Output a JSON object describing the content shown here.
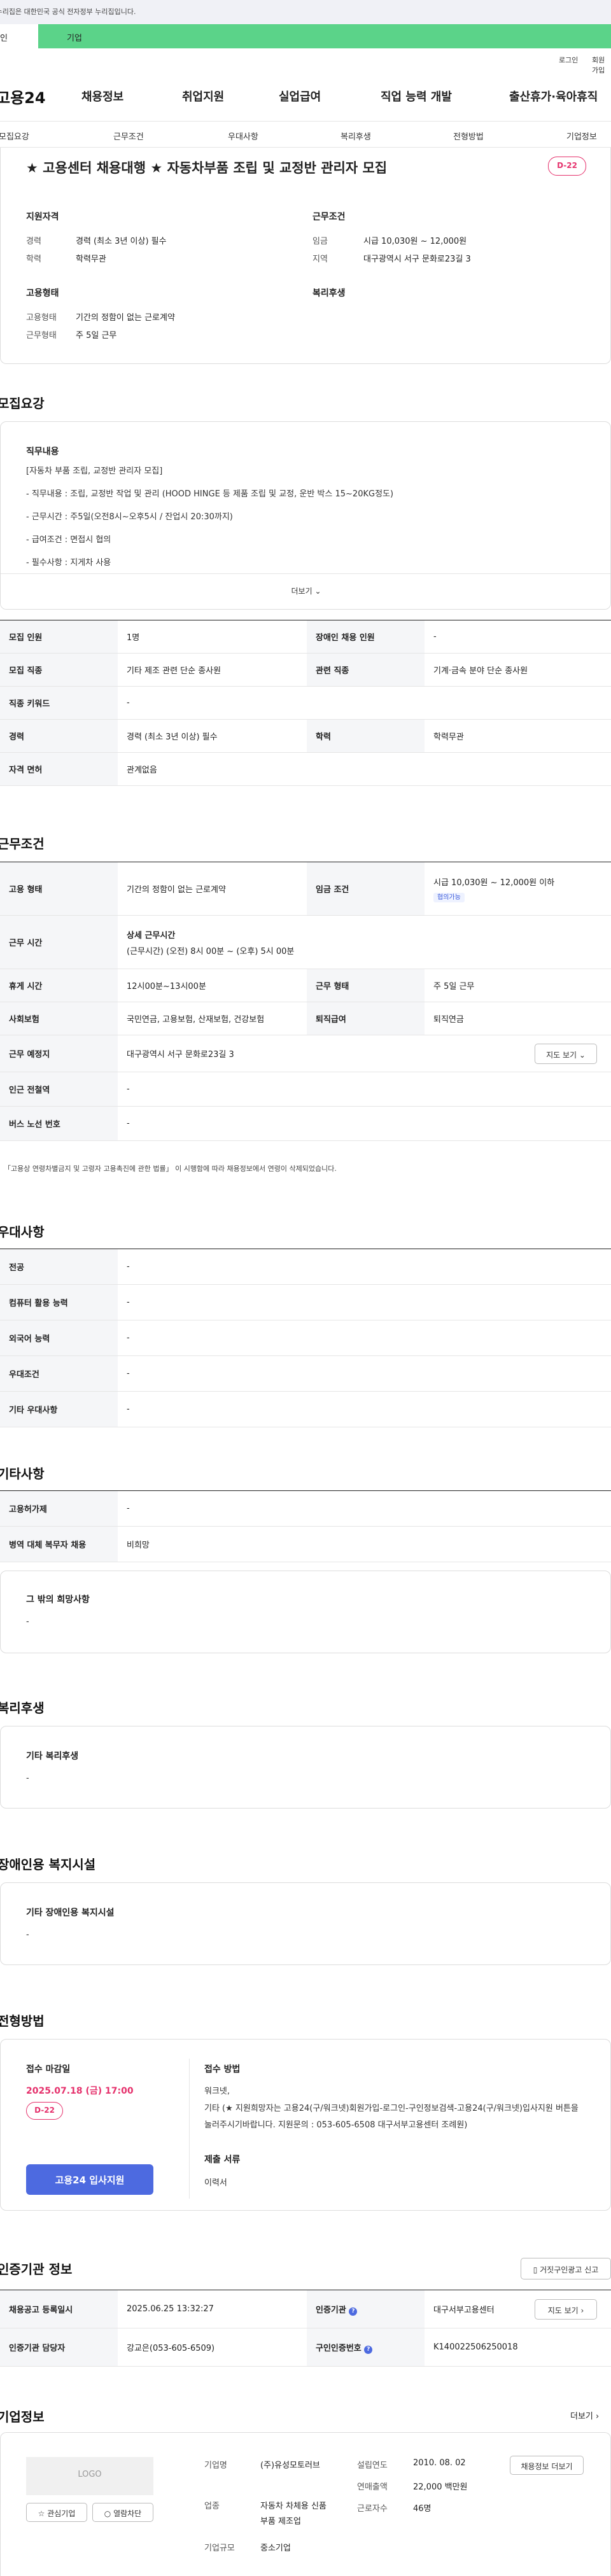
{
  "notice": "이 누리집은 대한민국 공식 전자정부 누리집입니다.",
  "tabs": {
    "individual": "개인",
    "company": "기업"
  },
  "util": {
    "login": "로그인",
    "join": "회원가입"
  },
  "gnb": {
    "logo": "고용24",
    "items": [
      "채용정보",
      "취업지원",
      "실업급여",
      "직업 능력 개발",
      "출산휴가·육아휴직"
    ]
  },
  "subnav": [
    "모집요강",
    "근무조건",
    "우대사항",
    "복리후생",
    "전형방법",
    "기업정보"
  ],
  "summary": {
    "title": "★ 고용센터 채용대행 ★ 자동차부품 조립 및 교정반 관리자 모집",
    "dday": "D-22",
    "qual_title": "지원자격",
    "career_lbl": "경력",
    "career": "경력 (최소 3년 이상) 필수",
    "edu_lbl": "학력",
    "edu": "학력무관",
    "cond_title": "근무조건",
    "wage_lbl": "임금",
    "wage": "시급 10,030원 ~ 12,000원",
    "region_lbl": "지역",
    "region": "대구광역시 서구 문화로23길 3",
    "emp_title": "고용형태",
    "emptype_lbl": "고용형태",
    "emptype": "기간의 정함이 없는 근로계약",
    "worktype_lbl": "근무형태",
    "worktype": "주 5일 근무",
    "welfare_title": "복리후생"
  },
  "recruit": {
    "title": "모집요강",
    "content_title": "직무내용",
    "lines": [
      "[자동차 부품 조립, 교정반 관리자 모집]",
      "- 직무내용 : 조립, 교정반 작업 및 관리 (HOOD HINGE 등 제품 조립 및 교정, 운반 박스 15~20KG정도)",
      "- 근무시간 : 주5일(오전8시~오후5시 / 잔업시 20:30까지)",
      "- 급여조건 : 면접시 협의",
      "- 필수사항 : 지게차 사용"
    ],
    "more": "더보기",
    "rows": [
      {
        "l1": "모집 인원",
        "v1": "1명",
        "l2": "장애인 채용 인원",
        "v2": "-"
      },
      {
        "l1": "모집 직종",
        "v1": "기타 제조 관련 단순 종사원",
        "l2": "관련 직종",
        "v2": "기계·금속 분야 단순 종사원"
      },
      {
        "l1": "직종 키워드",
        "v1": "-"
      },
      {
        "l1": "경력",
        "v1": "경력 (최소 3년 이상) 필수",
        "l2": "학력",
        "v2": "학력무관"
      },
      {
        "l1": "자격 면허",
        "v1": "관계없음"
      }
    ]
  },
  "work": {
    "title": "근무조건",
    "emptype_l": "고용 형태",
    "emptype": "기간의 정함이 없는 근로계약",
    "wage_l": "임금 조건",
    "wage": "시급 10,030원 ~ 12,000원 이하",
    "wage_tag": "협의가능",
    "hours_l": "근무 시간",
    "hours_title": "상세 근무시간",
    "hours": "(근무시간) (오전) 8시 00분 ~ (오후) 5시 00분",
    "break_l": "휴게 시간",
    "break": "12시00분~13시00분",
    "form_l": "근무 형태",
    "form": "주 5일 근무",
    "ins_l": "사회보험",
    "ins": "국민연금, 고용보험, 산재보험, 건강보험",
    "sev_l": "퇴직급여",
    "sev": "퇴직연금",
    "place_l": "근무 예정지",
    "place": "대구광역시 서구 문화로23길 3",
    "map": "지도 보기",
    "station_l": "인근 전철역",
    "station": "-",
    "bus_l": "버스 노선 번호",
    "bus": "-",
    "note": "「고용상 연령차별금지 및 고령자 고용촉진에 관한 법률」 이 시행함에 따라 채용정보에서 연령이 삭제되었습니다."
  },
  "pref": {
    "title": "우대사항",
    "rows": [
      {
        "l": "전공",
        "v": "-"
      },
      {
        "l": "컴퓨터 활용 능력",
        "v": "-"
      },
      {
        "l": "외국어 능력",
        "v": "-"
      },
      {
        "l": "우대조건",
        "v": "-"
      },
      {
        "l": "기타 우대사항",
        "v": "-"
      }
    ]
  },
  "etc": {
    "title": "기타사항",
    "rows": [
      {
        "l": "고용허가제",
        "v": "-"
      },
      {
        "l": "병역 대체 복무자 채용",
        "v": "비희망"
      }
    ],
    "other_title": "그 밖의 희망사항",
    "other": "-"
  },
  "welfare": {
    "title": "복리후생",
    "sub": "기타 복리후생",
    "val": "-"
  },
  "disab": {
    "title": "장애인용 복지시설",
    "sub": "기타 장애인용 복지시설",
    "val": "-"
  },
  "select": {
    "title": "전형방법",
    "deadline_l": "접수 마감일",
    "deadline": "2025.07.18 (금) 17:00",
    "dday": "D-22",
    "apply": "고용24 입사지원",
    "method_l": "접수 방법",
    "method1": "워크넷,",
    "method2": "기타 (★ 지원희망자는 고용24(구/워크넷)회원가입-로그인-구인정보검색-고용24(구/워크넷)입사지원 버튼을 눌러주시기바랍니다. 지원문의 : 053-605-6508 대구서부고용센터 조례원)",
    "docs_l": "제출 서류",
    "docs": "이력서"
  },
  "cert": {
    "title": "인증기관 정보",
    "report": "거짓구인광고 신고",
    "reg_l": "채용공고 등록일시",
    "reg": "2025.06.25 13:32:27",
    "org_l": "인증기관",
    "org": "대구서부고용센터",
    "map": "지도 보기",
    "mgr_l": "인증기관 담당자",
    "mgr": "강교은(053-605-6509)",
    "num_l": "구인인증번호",
    "num": "K140022506250018"
  },
  "company": {
    "title": "기업정보",
    "more": "더보기",
    "logo": "LOGO",
    "fav": "관심기업",
    "block": "열람차단",
    "name_l": "기업명",
    "name": "(주)유성모토러브",
    "year_l": "설립연도",
    "year": "2010. 08. 02",
    "list": "채용정보 더보기",
    "sales_l": "연매출액",
    "sales": "22,000 백만원",
    "ind_l": "업종",
    "ind": "자동차 차체용 신품 부품 제조업",
    "emp_l": "근로자수",
    "emp": "46명",
    "size_l": "기업규모",
    "size": "중소기업"
  }
}
